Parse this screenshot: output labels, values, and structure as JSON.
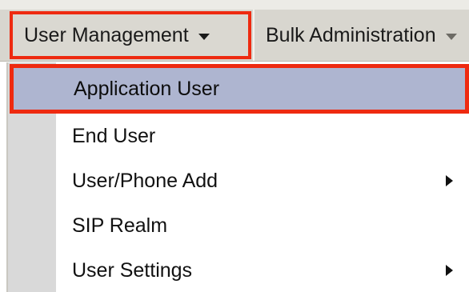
{
  "menubar": {
    "tabs": [
      {
        "label": "User Management",
        "icon": "chevron-down-icon"
      },
      {
        "label": "Bulk Administration",
        "icon": "chevron-down-icon"
      }
    ]
  },
  "dropdown": {
    "items": [
      {
        "label": "Application User",
        "selected": true,
        "has_submenu": false
      },
      {
        "label": "End User",
        "selected": false,
        "has_submenu": false
      },
      {
        "label": "User/Phone Add",
        "selected": false,
        "has_submenu": true
      },
      {
        "label": "SIP Realm",
        "selected": false,
        "has_submenu": false
      },
      {
        "label": "User Settings",
        "selected": false,
        "has_submenu": true
      }
    ]
  },
  "colors": {
    "highlight_border": "#ee2a10",
    "selected_background": "#aeb5d0",
    "menubar_background": "#d8d6cf",
    "gutter": "#d9d9d9"
  }
}
